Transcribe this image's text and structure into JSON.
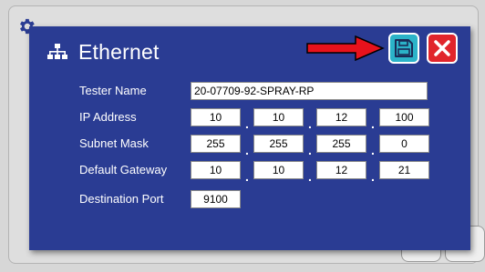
{
  "dialog": {
    "title": "Ethernet",
    "icon": "network-icon"
  },
  "toolbar": {
    "save_icon": "save-icon",
    "close_icon": "close-icon"
  },
  "form": {
    "tester_name": {
      "label": "Tester Name",
      "value": "20-07709-92-SPRAY-RP"
    },
    "ip_address": {
      "label": "IP Address",
      "octets": [
        "10",
        "10",
        "12",
        "100"
      ]
    },
    "subnet_mask": {
      "label": "Subnet Mask",
      "octets": [
        "255",
        "255",
        "255",
        "0"
      ]
    },
    "default_gateway": {
      "label": "Default Gateway",
      "octets": [
        "10",
        "10",
        "12",
        "21"
      ]
    },
    "destination_port": {
      "label": "Destination Port",
      "value": "9100"
    },
    "octet_separator": "."
  },
  "colors": {
    "dialog_bg": "#2a3c93",
    "save_button": "#2bb3c8",
    "close_button": "#e1252c",
    "arrow": "#e8121c"
  }
}
